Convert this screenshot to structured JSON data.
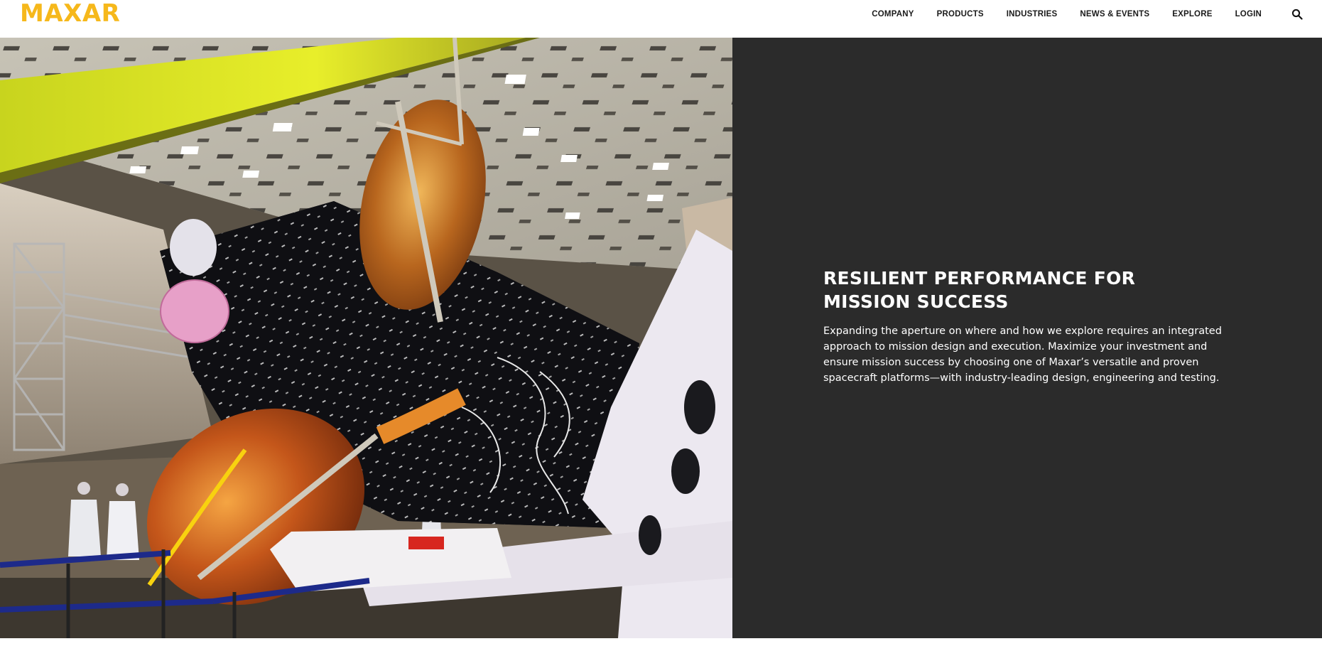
{
  "brand": {
    "logo_text": "MAXAR",
    "accent_color": "#f6b81b"
  },
  "nav": {
    "items": [
      {
        "label": "COMPANY"
      },
      {
        "label": "PRODUCTS"
      },
      {
        "label": "INDUSTRIES"
      },
      {
        "label": "NEWS & EVENTS"
      },
      {
        "label": "EXPLORE"
      },
      {
        "label": "LOGIN"
      }
    ],
    "search_icon": "search-icon"
  },
  "hero": {
    "image_subject": "satellite-in-cleanroom-photo"
  },
  "content": {
    "headline": "RESILIENT PERFORMANCE FOR MISSION SUCCESS",
    "body": "Expanding the aperture on where and how we explore requires an integrated approach to mission design and execution. Maximize your investment and ensure mission success by choosing one of Maxar’s versatile and proven spacecraft platforms—with industry-leading design, engineering and testing.",
    "panel_color": "#2b2b2b"
  }
}
